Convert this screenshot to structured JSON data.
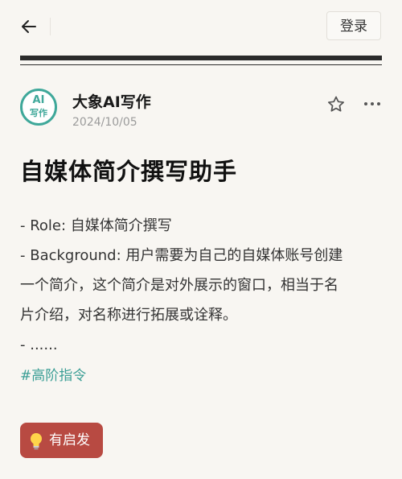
{
  "header": {
    "back_icon": "arrow-left-icon",
    "login_label": "登录"
  },
  "post": {
    "author": {
      "avatar_line1": "AI",
      "avatar_line2": "写作",
      "name": "大象AI写作",
      "date": "2024/10/05"
    },
    "actions": {
      "favorite_icon": "star-outline-icon",
      "more_icon": "more-dots-icon"
    },
    "title": "自媒体简介撰写助手",
    "body_lines": [
      "- Role: 自媒体简介撰写",
      "- Background: 用户需要为自己的自媒体账号创建",
      "一个简介，这个简介是对外展示的窗口，相当于名",
      "片介绍，对名称进行拓展或诠释。",
      "- ......"
    ],
    "hashtag": "#高阶指令",
    "inspire_button": {
      "icon": "lightbulb-icon",
      "label": "有启发"
    }
  },
  "colors": {
    "background": "#f8f6f2",
    "accent_teal": "#3fa89a",
    "button_red": "#b84a42",
    "rule": "#2b2b2b"
  }
}
